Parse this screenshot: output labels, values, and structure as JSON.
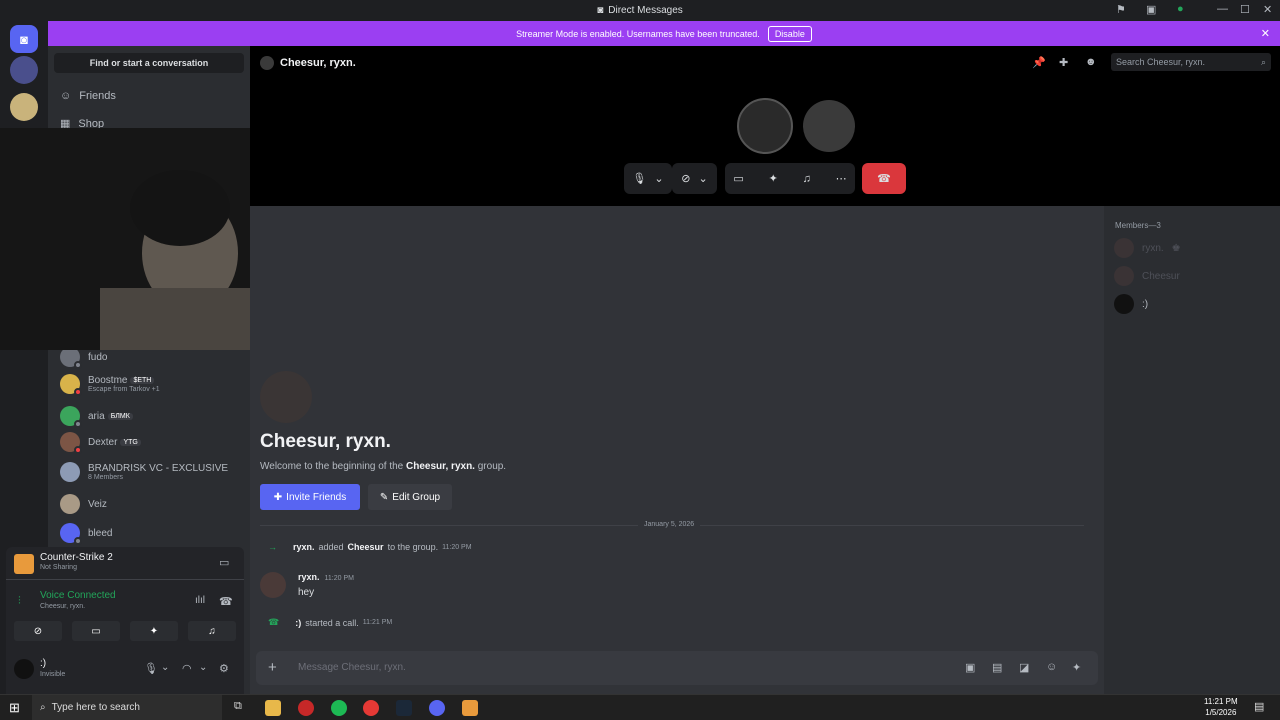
{
  "window": {
    "title": "Direct Messages"
  },
  "banner": {
    "text": "Streamer Mode is enabled. Usernames have been truncated.",
    "button": "Disable"
  },
  "sidebar": {
    "finder": "Find or start a conversation",
    "nav": [
      {
        "label": "Friends"
      },
      {
        "label": "Shop"
      }
    ],
    "dms": [
      {
        "name": "fudo",
        "sub": "",
        "badge": "",
        "color": "#6b6f78",
        "status": "#80848e"
      },
      {
        "name": "Boostme",
        "sub": "Escape from Tarkov +1",
        "badge": "$ETH",
        "color": "#d8b34a",
        "status": "#f23f43"
      },
      {
        "name": "aria",
        "sub": "",
        "badge": "БЛМК",
        "color": "#3ba55c",
        "status": "#80848e"
      },
      {
        "name": "Dexter",
        "sub": "",
        "badge": "YTG",
        "color": "#7c5545",
        "status": "#f23f43"
      },
      {
        "name": "BRANDRISK VC - EXCLUSIVE",
        "sub": "8 Members",
        "badge": "",
        "color": "#8d9bb5",
        "status": ""
      },
      {
        "name": "Veiz",
        "sub": "",
        "badge": "",
        "color": "#a99a86",
        "status": ""
      },
      {
        "name": "bleed",
        "sub": "",
        "badge": "",
        "color": "#5865f2",
        "status": "#80848e"
      }
    ]
  },
  "activity": {
    "game": "Counter-Strike 2",
    "game_sub": "Not Sharing",
    "voice": "Voice Connected",
    "voice_sub": "Cheesur, ryxn."
  },
  "user": {
    "name": ":)",
    "status": "Invisible"
  },
  "header": {
    "title": "Cheesur, ryxn.",
    "search_placeholder": "Search Cheesur, ryxn."
  },
  "chat": {
    "group_title": "Cheesur, ryxn.",
    "welcome_pre": "Welcome to the beginning of the",
    "welcome_bold": "Cheesur, ryxn.",
    "welcome_post": "group.",
    "invite": "Invite Friends",
    "edit": "Edit Group",
    "date_divider": "January 5, 2026",
    "sys1": {
      "actor": "ryxn.",
      "mid": "added",
      "target": "Cheesur",
      "tail": "to the group.",
      "time": "11:20 PM"
    },
    "msg": {
      "author": "ryxn.",
      "time": "11:20 PM",
      "text": "hey"
    },
    "sys2": {
      "actor": ":)",
      "text": "started a call.",
      "time": "11:21 PM"
    },
    "input_placeholder": "Message Cheesur, ryxn."
  },
  "members": {
    "header": "Members—3",
    "list": [
      "ryxn.",
      "Cheesur",
      ":)"
    ]
  },
  "taskbar": {
    "search": "Type here to search",
    "time": "11:21 PM",
    "date": "1/5/2026"
  }
}
